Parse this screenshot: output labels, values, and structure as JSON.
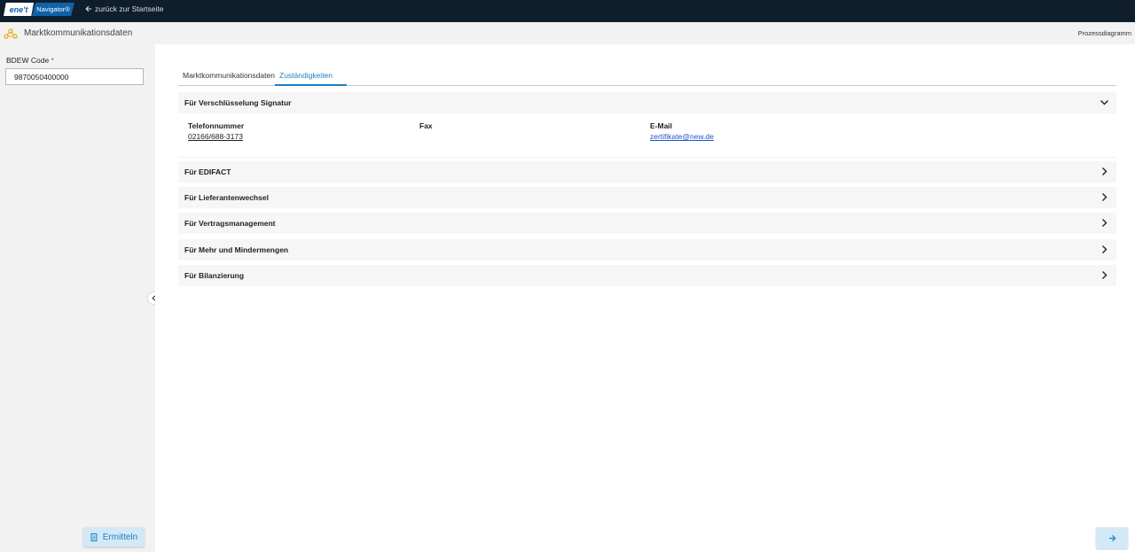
{
  "topbar": {
    "logo_left": "ene't",
    "logo_right": "Navigator®",
    "back_label": "zurück zur Startseite"
  },
  "subbar": {
    "title": "Marktkommunikationsdaten",
    "right_link": "Prozessdiagramm"
  },
  "sidebar": {
    "bdew_label": "BDEW Code",
    "required_mark": "*",
    "bdew_value": "9870050400000",
    "ermitteln_label": "Ermitteln"
  },
  "tabs": [
    {
      "label": "Marktkommunikationsdaten",
      "active": false
    },
    {
      "label": "Zuständigkeiten",
      "active": true
    }
  ],
  "sections": [
    {
      "title": "Für Verschlüsselung Signatur",
      "expanded": true,
      "fields": [
        {
          "label": "Telefonnummer",
          "value": "02166/688-3173"
        },
        {
          "label": "Fax",
          "value": ""
        },
        {
          "label": "E-Mail",
          "value": "zertifikate@new.de"
        }
      ]
    },
    {
      "title": "Für EDIFACT",
      "expanded": false
    },
    {
      "title": "Für Lieferantenwechsel",
      "expanded": false
    },
    {
      "title": "Für Vertragsmanagement",
      "expanded": false
    },
    {
      "title": "Für Mehr und Mindermengen",
      "expanded": false
    },
    {
      "title": "Für Bilanzierung",
      "expanded": false
    }
  ],
  "colors": {
    "topbar": "#0f1e2b",
    "accent": "#1a80c4",
    "button_bg": "#d4e9f7"
  }
}
